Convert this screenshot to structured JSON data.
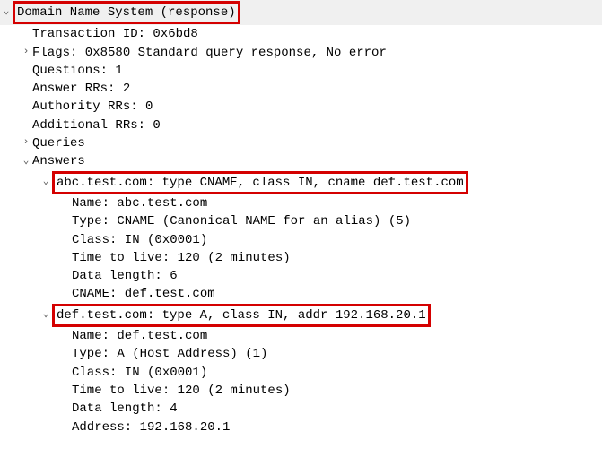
{
  "dns": {
    "header": "Domain Name System (response)",
    "transaction_id": "Transaction ID: 0x6bd8",
    "flags": "Flags: 0x8580 Standard query response, No error",
    "questions": "Questions: 1",
    "answer_rrs": "Answer RRs: 2",
    "authority_rrs": "Authority RRs: 0",
    "additional_rrs": "Additional RRs: 0",
    "queries_label": "Queries",
    "answers_label": "Answers",
    "answers": [
      {
        "summary": "abc.test.com: type CNAME, class IN, cname def.test.com",
        "name": "Name: abc.test.com",
        "type": "Type: CNAME (Canonical NAME for an alias) (5)",
        "class": "Class: IN (0x0001)",
        "ttl": "Time to live: 120 (2 minutes)",
        "data_length": "Data length: 6",
        "value": "CNAME: def.test.com"
      },
      {
        "summary": "def.test.com: type A, class IN, addr 192.168.20.1",
        "name": "Name: def.test.com",
        "type": "Type: A (Host Address) (1)",
        "class": "Class: IN (0x0001)",
        "ttl": "Time to live: 120 (2 minutes)",
        "data_length": "Data length: 4",
        "value": "Address: 192.168.20.1"
      }
    ]
  }
}
